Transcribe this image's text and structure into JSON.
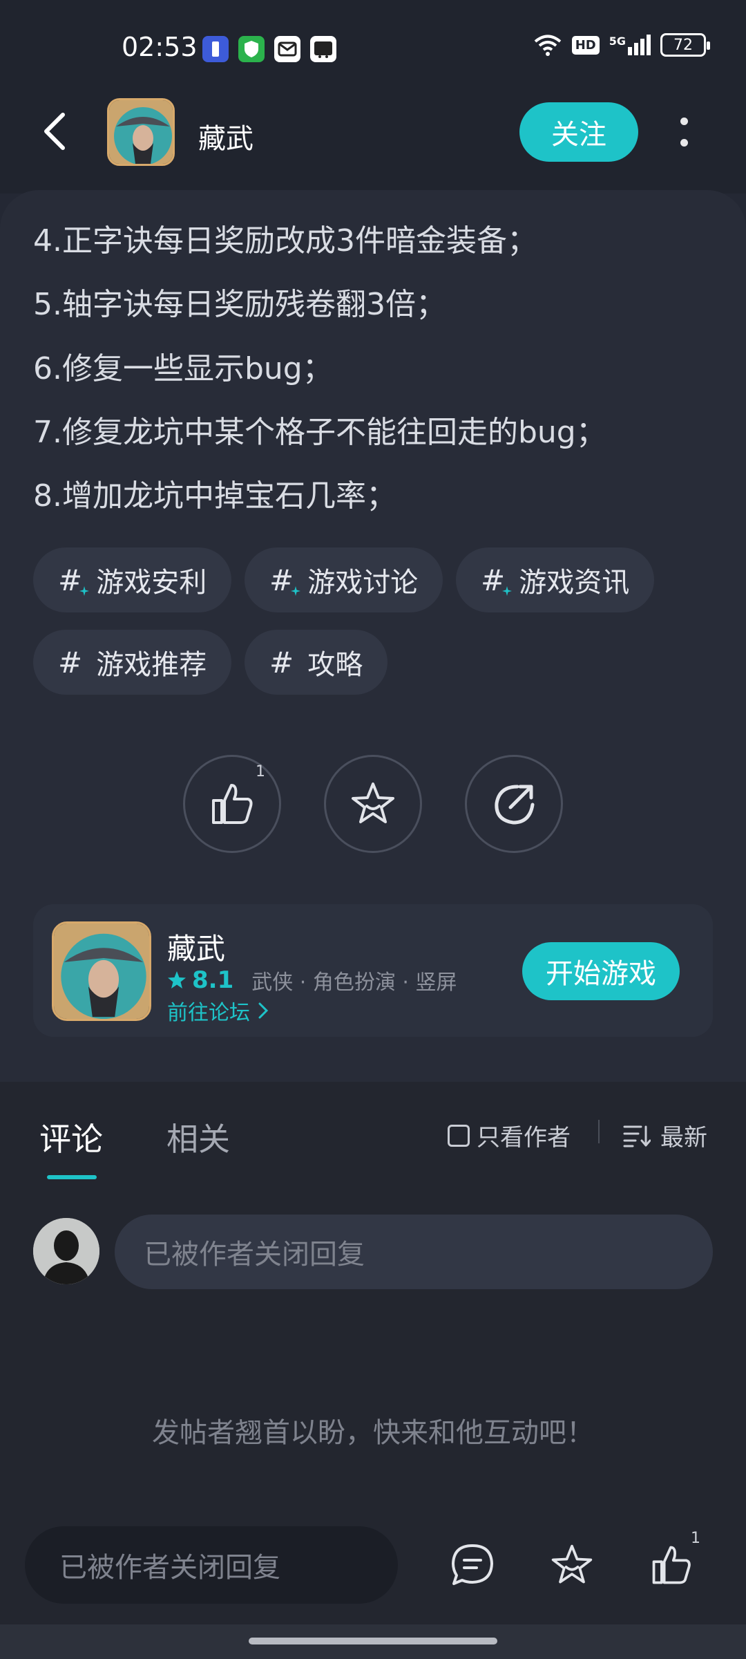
{
  "status_bar": {
    "time": "02:53",
    "battery": "72",
    "hd": "HD",
    "network": "5G"
  },
  "header": {
    "title": "藏武",
    "follow_label": "关注"
  },
  "post": {
    "lines": [
      "4.正字诀每日奖励改成3件暗金装备；",
      "5.轴字诀每日奖励残卷翻3倍；",
      "6.修复一些显示bug；",
      "7.修复龙坑中某个格子不能往回走的bug；",
      "8.增加龙坑中掉宝石几率；"
    ],
    "tags": [
      "游戏安利",
      "游戏讨论",
      "游戏资讯",
      "游戏推荐",
      "攻略"
    ],
    "hash_symbol": "#",
    "like_count": "1"
  },
  "game": {
    "name": "藏武",
    "rating": "8.1",
    "genres": "武侠 · 角色扮演 · 竖屏",
    "forum_link": "前往论坛",
    "start_label": "开始游戏"
  },
  "comments": {
    "tab_comment": "评论",
    "tab_related": "相关",
    "author_only": "只看作者",
    "sort_label": "最新",
    "reply_placeholder": "已被作者关闭回复",
    "empty_hint": "发帖者翘首以盼，快来和他互动吧！"
  },
  "bottom_bar": {
    "input_placeholder": "已被作者关闭回复",
    "like_count": "1"
  },
  "colors": {
    "accent": "#1ec3c8",
    "background": "#242834",
    "card": "#282c38"
  }
}
